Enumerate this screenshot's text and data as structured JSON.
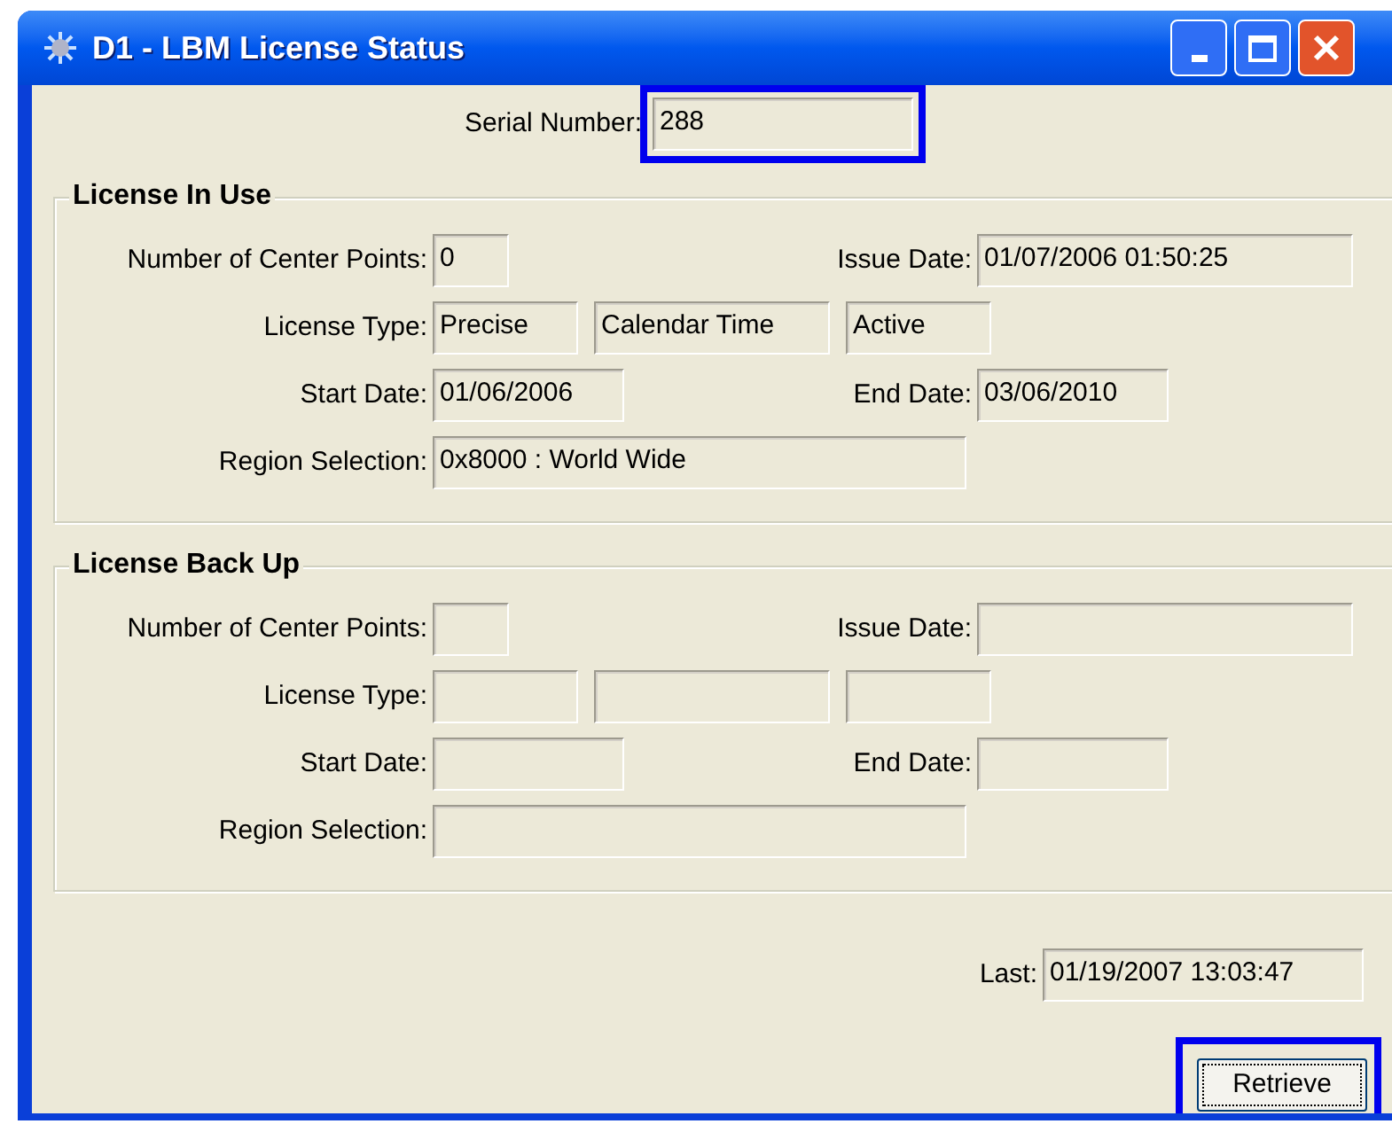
{
  "window": {
    "title": "D1 - LBM License Status"
  },
  "serial_number": {
    "label": "Serial Number:",
    "value": "288",
    "highlighted": true
  },
  "groups": [
    {
      "title": "License In Use",
      "center_points": {
        "label": "Number of Center Points:",
        "value": "0"
      },
      "issue_date": {
        "label": "Issue Date:",
        "value": "01/07/2006 01:50:25"
      },
      "license_type": {
        "label": "License Type:",
        "values": [
          {
            "kind": "filled",
            "text": "Precise"
          },
          {
            "kind": "filled",
            "text": "Calendar Time"
          },
          {
            "kind": "filled",
            "text": "Active"
          }
        ]
      },
      "start_date": {
        "label": "Start Date:",
        "value": "01/06/2006"
      },
      "end_date": {
        "label": "End Date:",
        "value": "03/06/2010"
      },
      "region_selection": {
        "label": "Region Selection:",
        "value": "0x8000 : World Wide"
      }
    },
    {
      "title": "License Back Up",
      "center_points": {
        "label": "Number of Center Points:"
      },
      "issue_date": {
        "label": "Issue Date:"
      },
      "license_type": {
        "label": "License Type:",
        "values": [
          {
            "kind": "blank"
          },
          {
            "kind": "blank"
          },
          {
            "kind": "blank"
          }
        ]
      },
      "start_date": {
        "label": "Start Date:"
      },
      "end_date": {
        "label": "End Date:"
      },
      "region_selection": {
        "label": "Region Selection:"
      }
    }
  ],
  "last": {
    "label": "Last:",
    "value": "01/19/2007 13:03:47"
  },
  "retrieve_button": {
    "label": "Retrieve",
    "highlighted": true
  }
}
